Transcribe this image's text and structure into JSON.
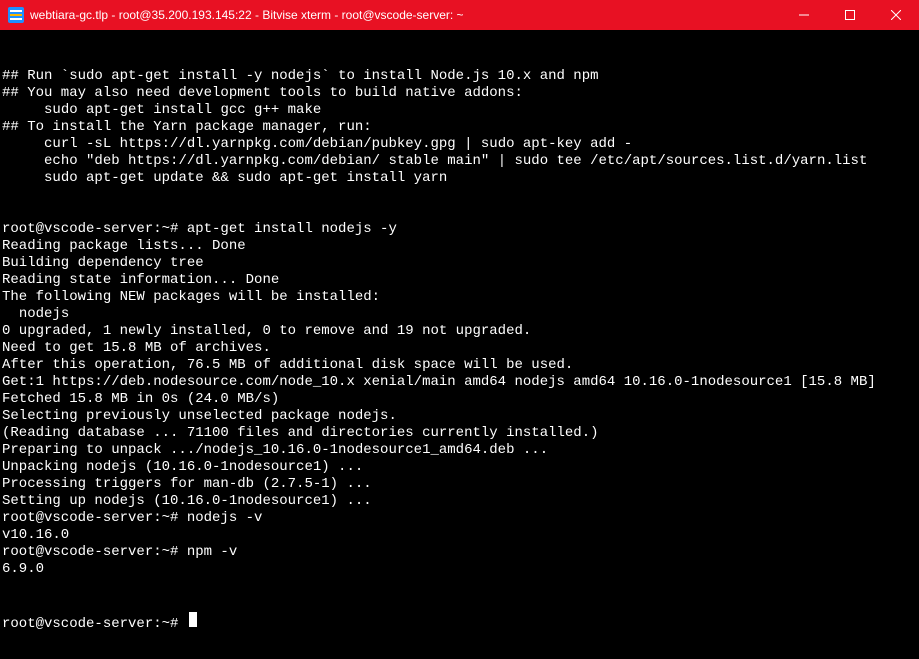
{
  "titlebar": {
    "title": "webtiara-gc.tlp - root@35.200.193.145:22 - Bitvise xterm - root@vscode-server: ~"
  },
  "terminal": {
    "lines": [
      "## Run `sudo apt-get install -y nodejs` to install Node.js 10.x and npm",
      "## You may also need development tools to build native addons:",
      "     sudo apt-get install gcc g++ make",
      "## To install the Yarn package manager, run:",
      "     curl -sL https://dl.yarnpkg.com/debian/pubkey.gpg | sudo apt-key add -",
      "     echo \"deb https://dl.yarnpkg.com/debian/ stable main\" | sudo tee /etc/apt/sources.list.d/yarn.list",
      "     sudo apt-get update && sudo apt-get install yarn",
      "",
      "",
      "root@vscode-server:~# apt-get install nodejs -y",
      "Reading package lists... Done",
      "Building dependency tree",
      "Reading state information... Done",
      "The following NEW packages will be installed:",
      "  nodejs",
      "0 upgraded, 1 newly installed, 0 to remove and 19 not upgraded.",
      "Need to get 15.8 MB of archives.",
      "After this operation, 76.5 MB of additional disk space will be used.",
      "Get:1 https://deb.nodesource.com/node_10.x xenial/main amd64 nodejs amd64 10.16.0-1nodesource1 [15.8 MB]",
      "Fetched 15.8 MB in 0s (24.0 MB/s)",
      "Selecting previously unselected package nodejs.",
      "(Reading database ... 71100 files and directories currently installed.)",
      "Preparing to unpack .../nodejs_10.16.0-1nodesource1_amd64.deb ...",
      "Unpacking nodejs (10.16.0-1nodesource1) ...",
      "Processing triggers for man-db (2.7.5-1) ...",
      "Setting up nodejs (10.16.0-1nodesource1) ...",
      "root@vscode-server:~# nodejs -v",
      "v10.16.0",
      "root@vscode-server:~# npm -v",
      "6.9.0"
    ],
    "current_prompt": "root@vscode-server:~# "
  }
}
